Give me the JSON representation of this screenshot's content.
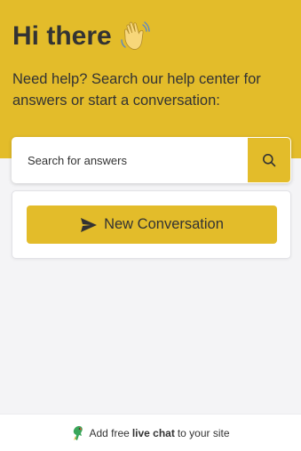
{
  "header": {
    "greeting": "Hi there",
    "wave_icon": "waving-hand-emoji",
    "subtitle": "Need help? Search our help center for answers or start a conversation:"
  },
  "search": {
    "placeholder": "Search for answers",
    "button_icon": "search-icon"
  },
  "conversation": {
    "button_label": "New Conversation",
    "button_icon": "send-icon"
  },
  "footer": {
    "prefix": "Add free",
    "bold": "live chat",
    "suffix": "to your site",
    "logo_icon": "parrot-logo-icon"
  },
  "colors": {
    "accent": "#e3bc2a",
    "text": "#333333",
    "background": "#f4f4f6"
  }
}
